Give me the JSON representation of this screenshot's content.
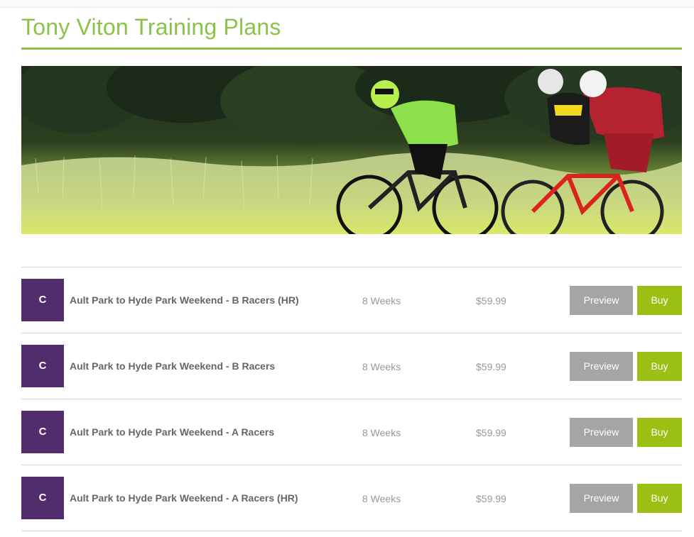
{
  "page": {
    "title": "Tony Viton Training Plans"
  },
  "colors": {
    "title_green": "#8bc34a",
    "avatar_purple": "#522d6e",
    "preview_gray": "#a5a5a5",
    "buy_green": "#9bbf12"
  },
  "hero": {
    "description_icon": "cyclists-banner-image"
  },
  "plans": [
    {
      "coach_initial": "C",
      "name": "Ault Park to Hyde Park Weekend - B Racers (HR)",
      "duration": "8 Weeks",
      "price": "$59.99",
      "preview_label": "Preview",
      "buy_label": "Buy"
    },
    {
      "coach_initial": "C",
      "name": "Ault Park to Hyde Park Weekend - B Racers",
      "duration": "8 Weeks",
      "price": "$59.99",
      "preview_label": "Preview",
      "buy_label": "Buy"
    },
    {
      "coach_initial": "C",
      "name": "Ault Park to Hyde Park Weekend - A Racers",
      "duration": "8 Weeks",
      "price": "$59.99",
      "preview_label": "Preview",
      "buy_label": "Buy"
    },
    {
      "coach_initial": "C",
      "name": "Ault Park to Hyde Park Weekend - A Racers (HR)",
      "duration": "8 Weeks",
      "price": "$59.99",
      "preview_label": "Preview",
      "buy_label": "Buy"
    }
  ]
}
